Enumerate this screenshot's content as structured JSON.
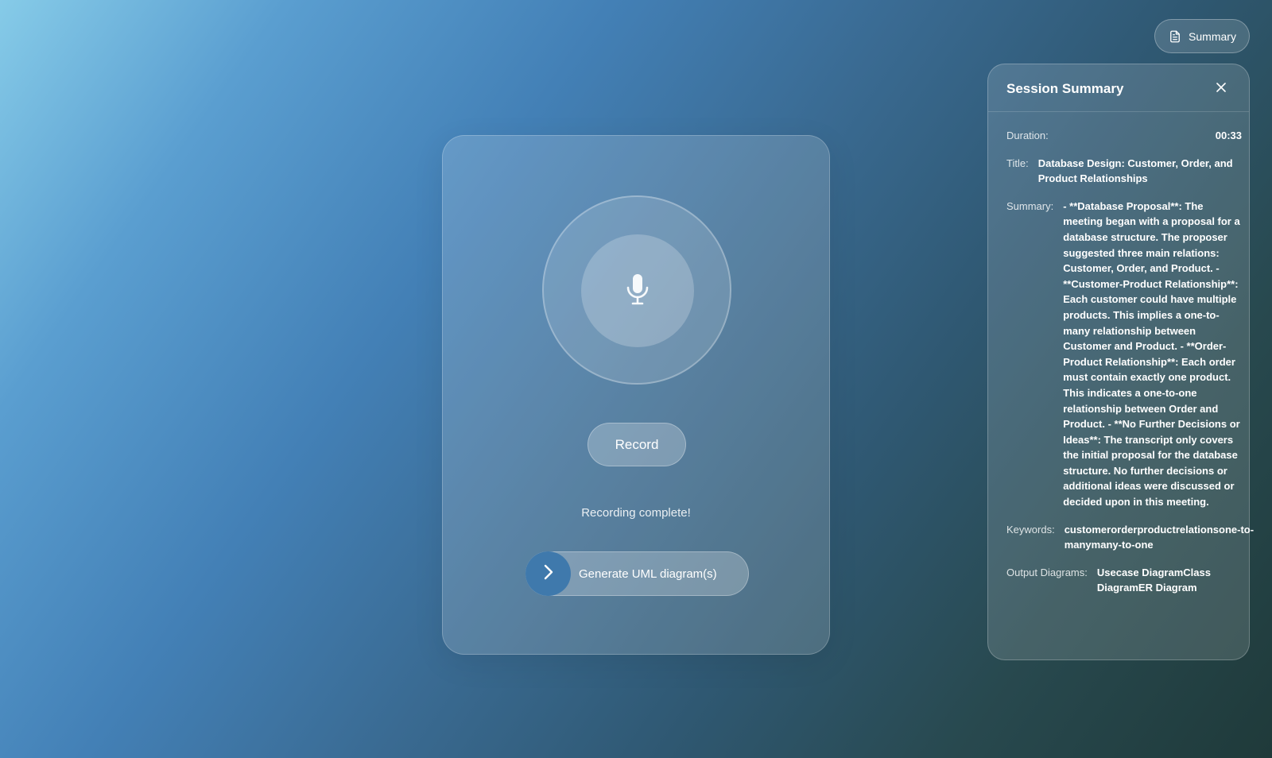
{
  "header": {
    "summary_button_label": "Summary"
  },
  "recorder": {
    "record_label": "Record",
    "status": "Recording complete!",
    "generate_label": "Generate UML diagram(s)"
  },
  "summary_panel": {
    "title": "Session Summary",
    "duration_label": "Duration:",
    "duration_value": "00:33",
    "title_label": "Title:",
    "title_value": "Database Design: Customer, Order, and Product Relationships",
    "summary_label": "Summary:",
    "summary_value": "- **Database Proposal**: The meeting began with a proposal for a database structure. The proposer suggested three main relations: Customer, Order, and Product. - **Customer-Product Relationship**: Each customer could have multiple products. This implies a one-to-many relationship between Customer and Product. - **Order-Product Relationship**: Each order must contain exactly one product. This indicates a one-to-one relationship between Order and Product. - **No Further Decisions or Ideas**: The transcript only covers the initial proposal for the database structure. No further decisions or additional ideas were discussed or decided upon in this meeting.",
    "keywords_label": "Keywords:",
    "keywords_value": "customerorderproductrelationsone-to-manymany-to-one",
    "output_label": "Output Diagrams:",
    "output_value": "Usecase DiagramClass DiagramER Diagram"
  },
  "icons": {
    "summary": "document-icon",
    "mic": "microphone-icon",
    "generate": "chevron-right-icon",
    "close": "close-icon"
  },
  "colors": {
    "accent": "#3f79ac"
  }
}
